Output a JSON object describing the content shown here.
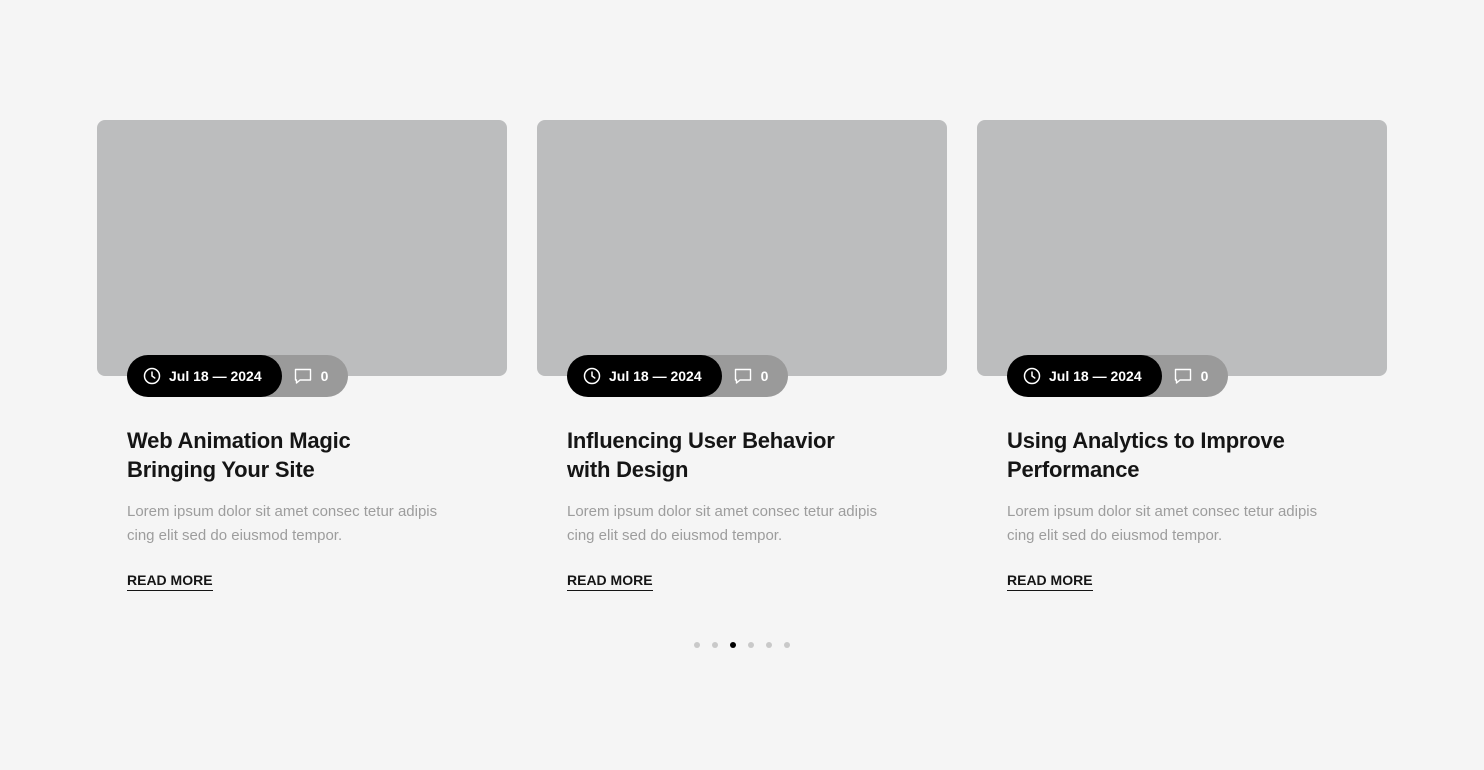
{
  "cards": [
    {
      "date": "Jul 18 — 2024",
      "comments": "0",
      "title": "Web Animation Magic Bringing Your Site",
      "excerpt": "Lorem ipsum dolor sit amet consec tetur adipis cing elit sed do eiusmod tempor.",
      "link_label": "READ MORE"
    },
    {
      "date": "Jul 18 — 2024",
      "comments": "0",
      "title": "Influencing User Behavior with Design",
      "excerpt": "Lorem ipsum dolor sit amet consec tetur adipis cing elit sed do eiusmod tempor.",
      "link_label": "READ MORE"
    },
    {
      "date": "Jul 18 — 2024",
      "comments": "0",
      "title": "Using Analytics to Improve Performance",
      "excerpt": "Lorem ipsum dolor sit amet consec tetur adipis cing elit sed do eiusmod tempor.",
      "link_label": "READ MORE"
    }
  ],
  "pagination": {
    "total": 6,
    "active_index": 2
  },
  "icons": {
    "date": "clock-icon",
    "comments": "comment-icon"
  },
  "colors": {
    "background": "#f5f5f5",
    "thumbnail": "#bcbdbe",
    "date_pill": "#000000",
    "comment_pill": "#9a9a9a",
    "title": "#151515",
    "excerpt": "#9d9d9d",
    "dot_inactive": "#c9c9c9",
    "dot_active": "#000000"
  }
}
